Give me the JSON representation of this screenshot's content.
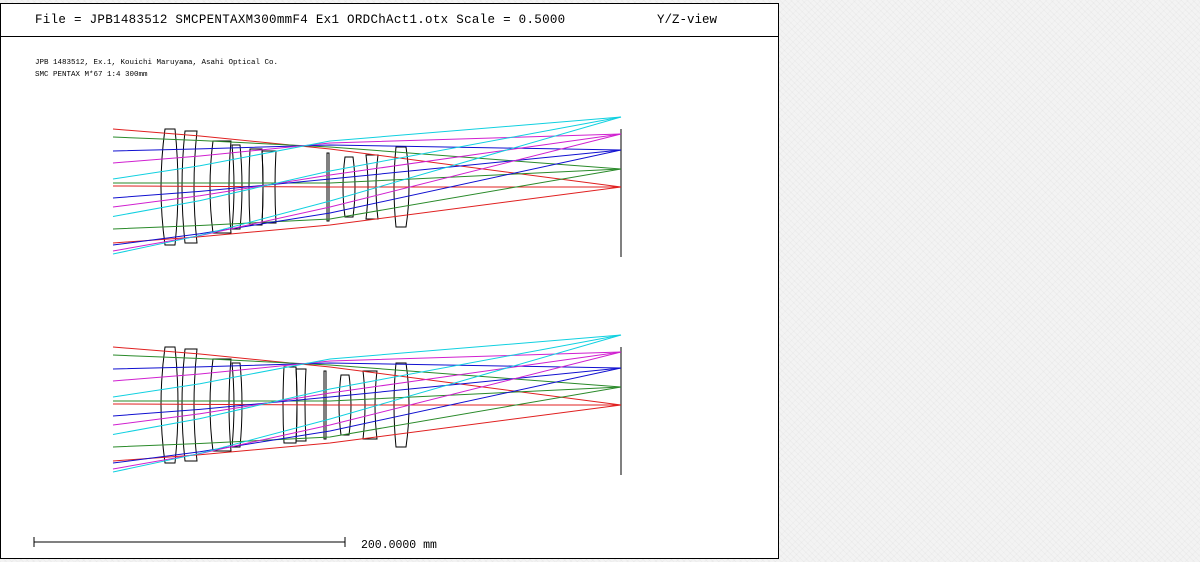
{
  "header": {
    "file_line": "File = JPB1483512 SMCPENTAXM300mmF4 Ex1 ORDChAct1.otx Scale = 0.5000",
    "view": "Y/Z-view"
  },
  "captions": [
    "JPB 1483512, Ex.1, Kouichi Maruyama, Asahi Optical Co.",
    "SMC PENTAX M*67 1:4 300mm"
  ],
  "scale_bar": {
    "label": "200.0000 mm"
  },
  "colors": {
    "lens": "#000000",
    "ray_red": "#e02020",
    "ray_green": "#2a8a2a",
    "ray_blue": "#1010d0",
    "ray_magenta": "#d020d0",
    "ray_cyan": "#10d0e0"
  }
}
